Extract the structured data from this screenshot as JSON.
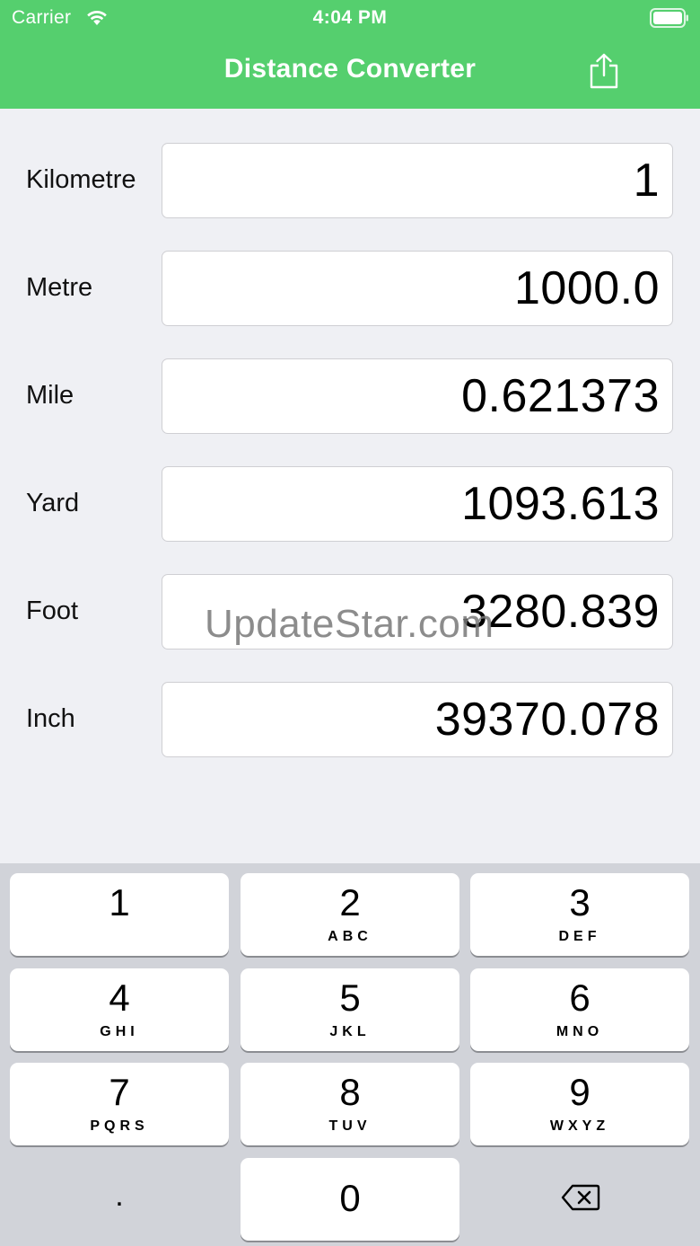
{
  "status_bar": {
    "carrier": "Carrier",
    "time": "4:04 PM"
  },
  "nav": {
    "title": "Distance Converter",
    "share_icon": "share-icon"
  },
  "rows": [
    {
      "label": "Kilometre",
      "value": "1"
    },
    {
      "label": "Metre",
      "value": "1000.0"
    },
    {
      "label": "Mile",
      "value": "0.621373"
    },
    {
      "label": "Yard",
      "value": "1093.613"
    },
    {
      "label": "Foot",
      "value": "3280.839"
    },
    {
      "label": "Inch",
      "value": "39370.078"
    }
  ],
  "watermark": "UpdateStar.com",
  "keypad": {
    "keys": [
      {
        "digit": "1",
        "letters": ""
      },
      {
        "digit": "2",
        "letters": "ABC"
      },
      {
        "digit": "3",
        "letters": "DEF"
      },
      {
        "digit": "4",
        "letters": "GHI"
      },
      {
        "digit": "5",
        "letters": "JKL"
      },
      {
        "digit": "6",
        "letters": "MNO"
      },
      {
        "digit": "7",
        "letters": "PQRS"
      },
      {
        "digit": "8",
        "letters": "TUV"
      },
      {
        "digit": "9",
        "letters": "WXYZ"
      },
      {
        "digit": "0",
        "letters": ""
      }
    ],
    "dot": ".",
    "delete_icon": "backspace-icon"
  },
  "colors": {
    "header": "#55cf6e",
    "background": "#eff0f4",
    "keypad": "#d1d3d9"
  }
}
